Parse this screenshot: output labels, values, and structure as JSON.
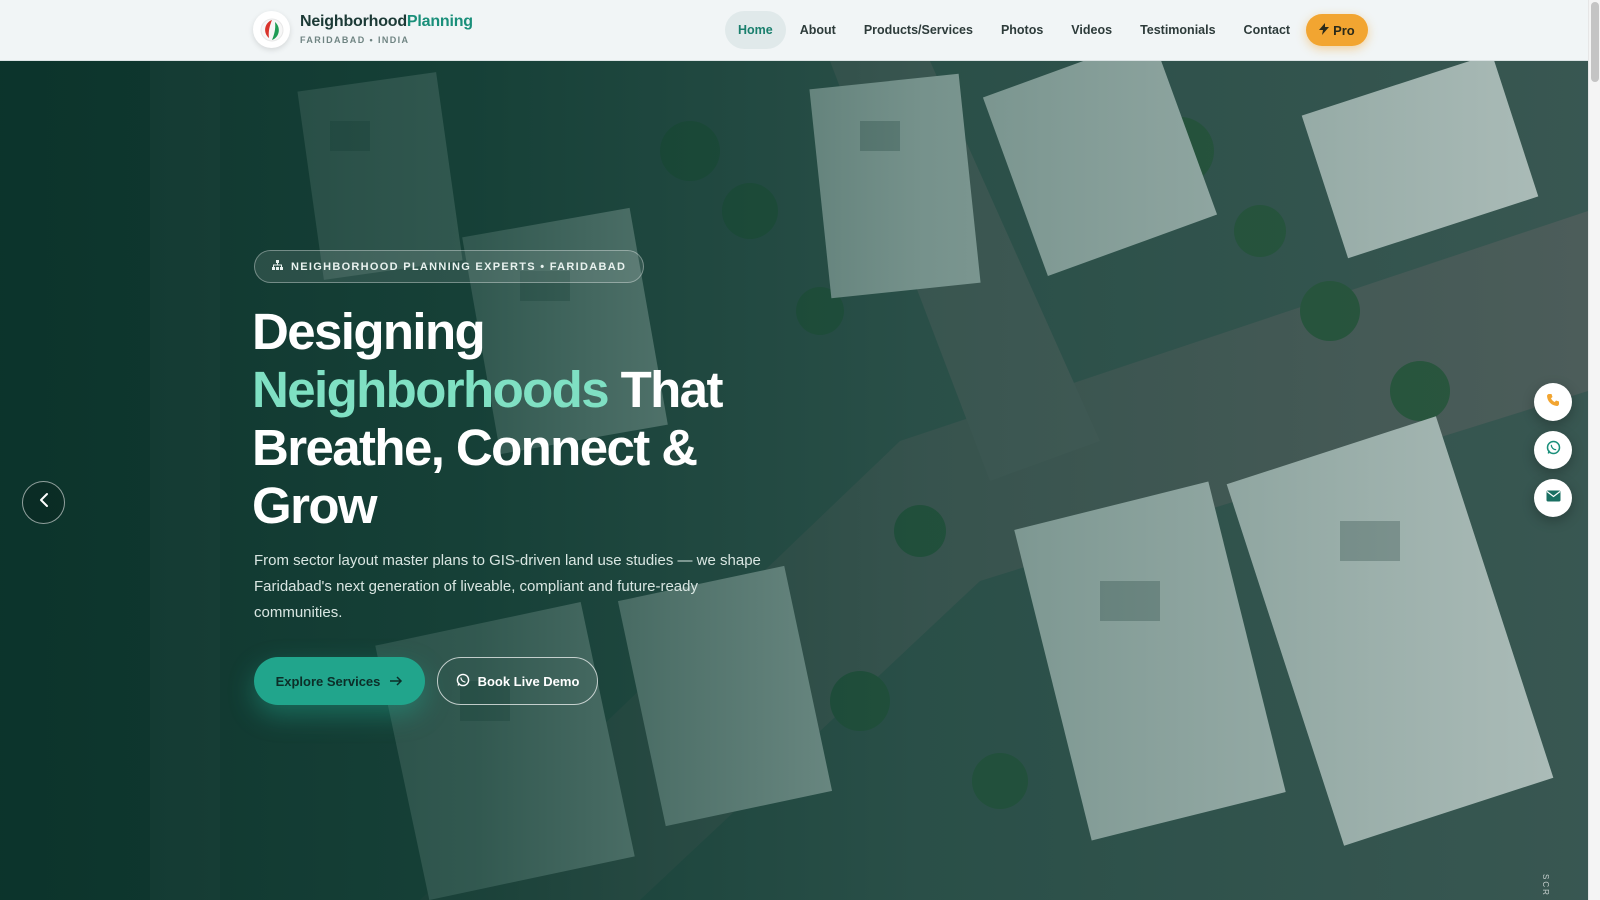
{
  "brand": {
    "name_main": "Neighborhood",
    "name_accent": "Planning",
    "tagline": "FARIDABAD • INDIA"
  },
  "nav": {
    "items": [
      {
        "label": "Home",
        "active": true
      },
      {
        "label": "About"
      },
      {
        "label": "Products/Services"
      },
      {
        "label": "Photos"
      },
      {
        "label": "Videos"
      },
      {
        "label": "Testimonials"
      },
      {
        "label": "Contact"
      }
    ],
    "pro_label": "Pro"
  },
  "hero": {
    "badge": "NEIGHBORHOOD PLANNING EXPERTS • FARIDABAD",
    "headline_1": "Designing",
    "headline_highlight": "Neighborhoods",
    "headline_2": "That Breathe, Connect & Grow",
    "lead": "From sector layout master plans to GIS-driven land use studies — we shape Faridabad's next generation of liveable, compliant and future-ready communities.",
    "primary_cta": "Explore Services",
    "secondary_cta": "Book Live Demo",
    "scroll_hint": "SCR"
  },
  "floating_actions": [
    {
      "icon": "phone-icon"
    },
    {
      "icon": "whatsapp-icon"
    },
    {
      "icon": "mail-icon"
    }
  ],
  "colors": {
    "accent": "#21a58c",
    "highlight": "#7fe0c3",
    "pro": "#f2a531",
    "hero_dark": "#0f3a32"
  }
}
